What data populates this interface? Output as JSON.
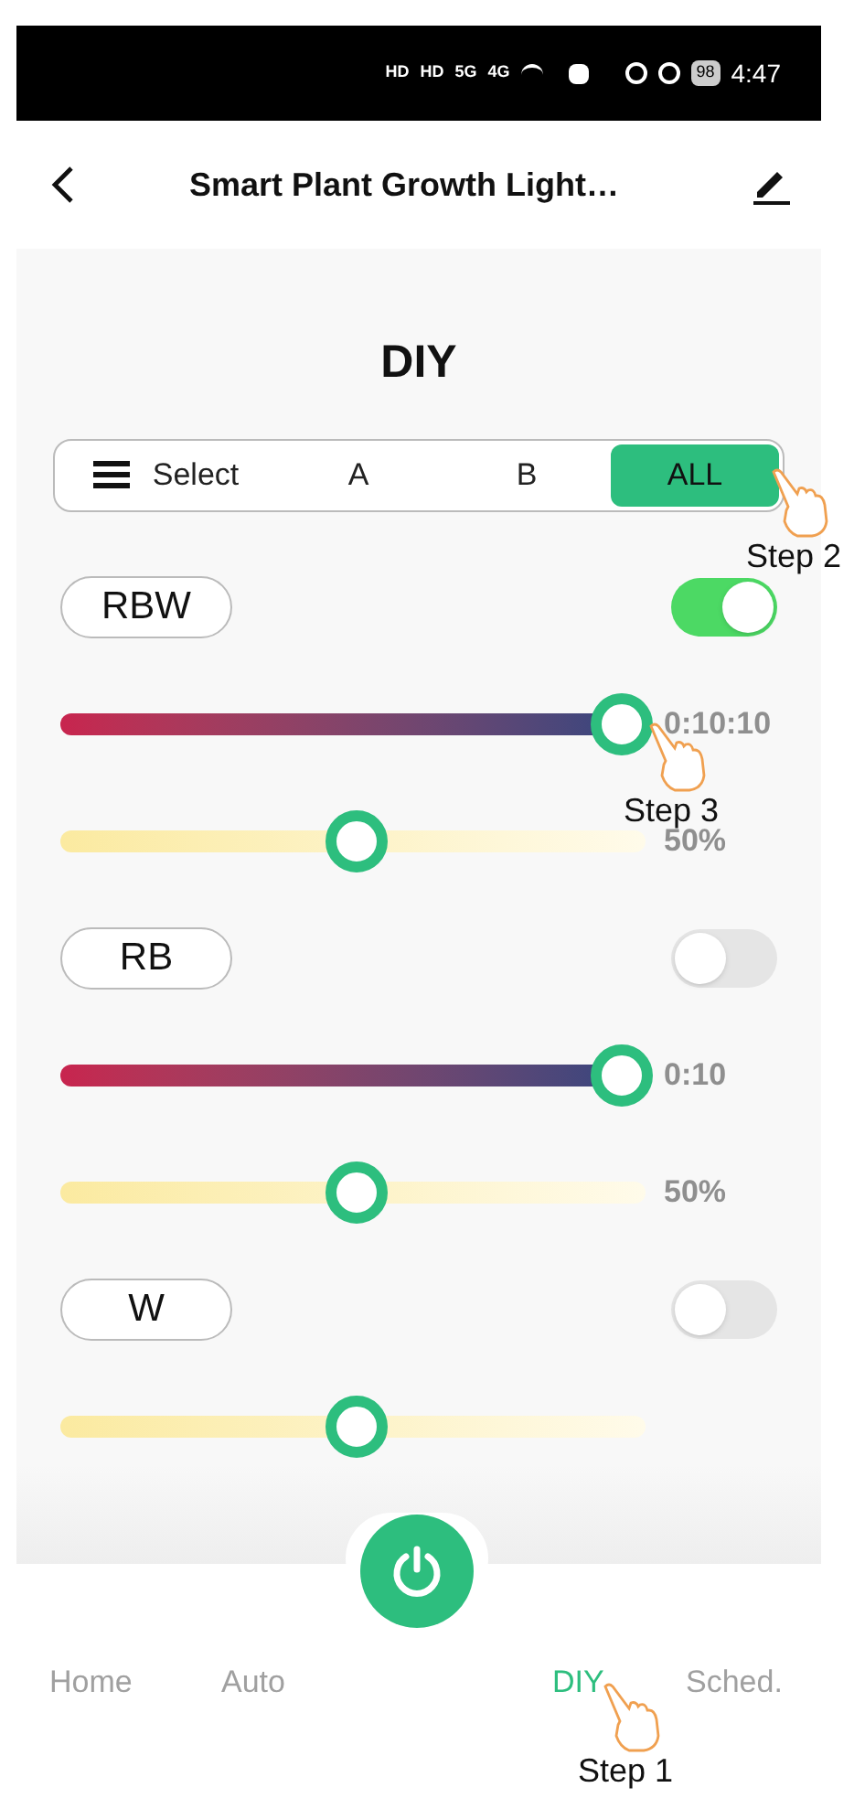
{
  "status_bar": {
    "left": [
      "HD",
      "HD",
      "5G",
      "4G"
    ],
    "battery": "98",
    "time": "4:47"
  },
  "header": {
    "title": "Smart Plant Growth Light…"
  },
  "page_title": "DIY",
  "selector": [
    {
      "label": "Select",
      "kind": "menu",
      "selected": false
    },
    {
      "label": "A",
      "kind": "group",
      "selected": false
    },
    {
      "label": "B",
      "kind": "group",
      "selected": false
    },
    {
      "label": "ALL",
      "kind": "group",
      "selected": true,
      "step": "Step 2"
    }
  ],
  "channels": [
    {
      "name": "RBW",
      "on": true,
      "sliders": [
        {
          "kind": "time",
          "level": 1.0,
          "reading": "0:10:10",
          "step": "Step 3"
        },
        {
          "kind": "brightness",
          "level": 0.5,
          "reading": "50%"
        }
      ]
    },
    {
      "name": "RB",
      "on": false,
      "sliders": [
        {
          "kind": "time",
          "level": 1.0,
          "reading": "0:10"
        },
        {
          "kind": "brightness",
          "level": 0.5,
          "reading": "50%"
        }
      ]
    },
    {
      "name": "W",
      "on": false,
      "sliders": [
        {
          "kind": "brightness",
          "level": 0.5
        }
      ]
    }
  ],
  "nav": [
    {
      "label": "Home",
      "selected": false
    },
    {
      "label": "Auto",
      "selected": false
    },
    {
      "label": "DIY",
      "selected": true,
      "step": "Step 1"
    },
    {
      "label": "Sched.",
      "selected": false
    }
  ]
}
